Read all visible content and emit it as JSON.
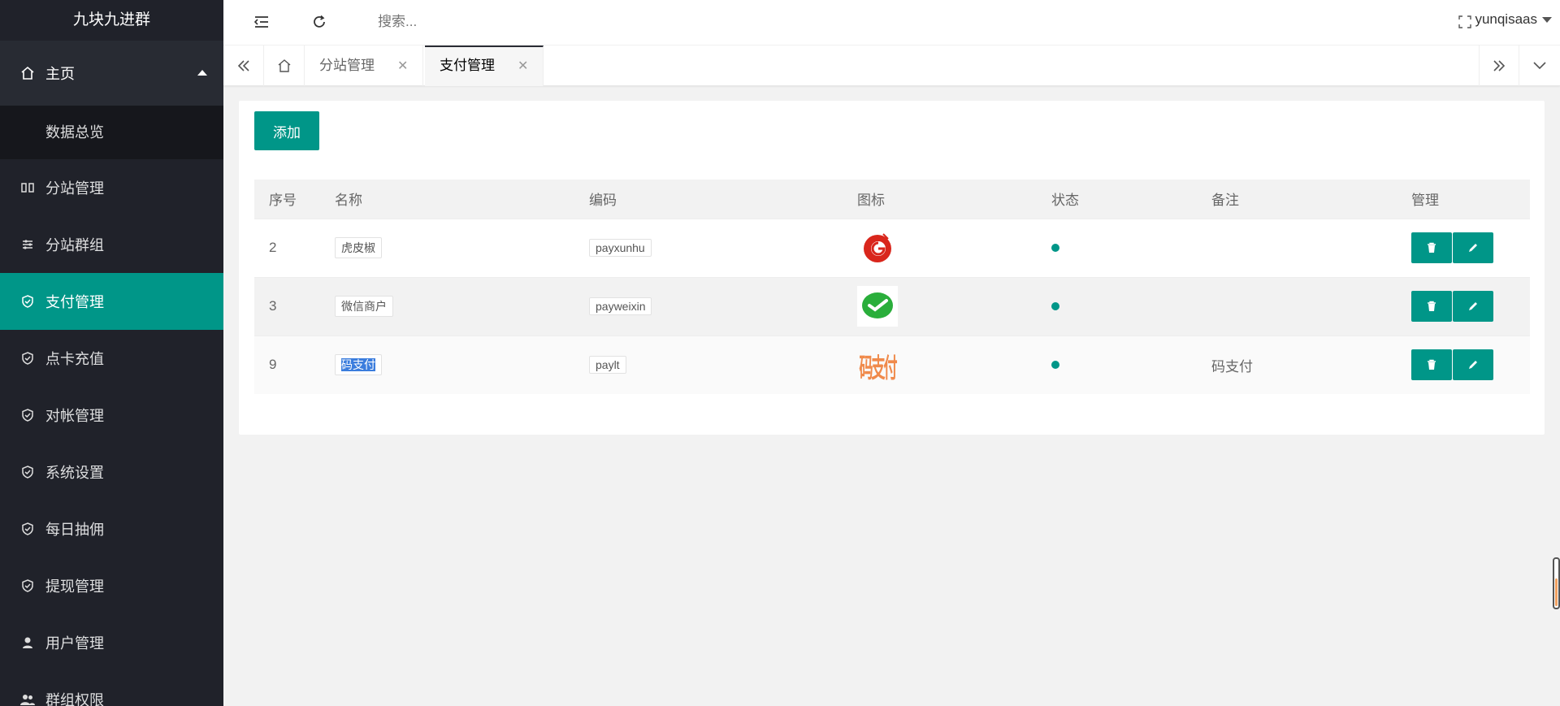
{
  "app": {
    "title": "九块九进群"
  },
  "sidebar": {
    "home": {
      "label": "主页",
      "icon": "home-icon"
    },
    "home_sub": [
      {
        "label": "数据总览"
      }
    ],
    "items": [
      {
        "label": "分站管理",
        "icon": "columns-icon"
      },
      {
        "label": "分站群组",
        "icon": "sliders-icon"
      },
      {
        "label": "支付管理",
        "icon": "shield-check-icon",
        "active": true
      },
      {
        "label": "点卡充值",
        "icon": "shield-check-icon"
      },
      {
        "label": "对帐管理",
        "icon": "shield-check-icon"
      },
      {
        "label": "系统设置",
        "icon": "shield-check-icon"
      },
      {
        "label": "每日抽佣",
        "icon": "shield-check-icon"
      },
      {
        "label": "提现管理",
        "icon": "shield-check-icon"
      },
      {
        "label": "用户管理",
        "icon": "user-icon"
      },
      {
        "label": "群组权限",
        "icon": "users-icon"
      }
    ]
  },
  "header": {
    "search_placeholder": "搜索...",
    "username": "yunqisaas"
  },
  "tabs": [
    {
      "label": "分站管理",
      "active": false
    },
    {
      "label": "支付管理",
      "active": true
    }
  ],
  "toolbar": {
    "add_label": "添加"
  },
  "table": {
    "columns": [
      "序号",
      "名称",
      "编码",
      "图标",
      "状态",
      "备注",
      "管理"
    ],
    "rows": [
      {
        "id": "2",
        "name": "虎皮椒",
        "code": "payxunhu",
        "icon": "xunhu-logo",
        "status": "enabled",
        "remark": ""
      },
      {
        "id": "3",
        "name": "微信商户",
        "code": "payweixin",
        "icon": "wechat-logo",
        "status": "enabled",
        "remark": ""
      },
      {
        "id": "9",
        "name": "码支付",
        "code": "paylt",
        "icon": "mazhifu-logo",
        "icon_text": "码支付",
        "status": "enabled",
        "remark": "码支付"
      }
    ]
  },
  "colors": {
    "accent": "#009688",
    "sidebar_bg": "#20222a"
  }
}
